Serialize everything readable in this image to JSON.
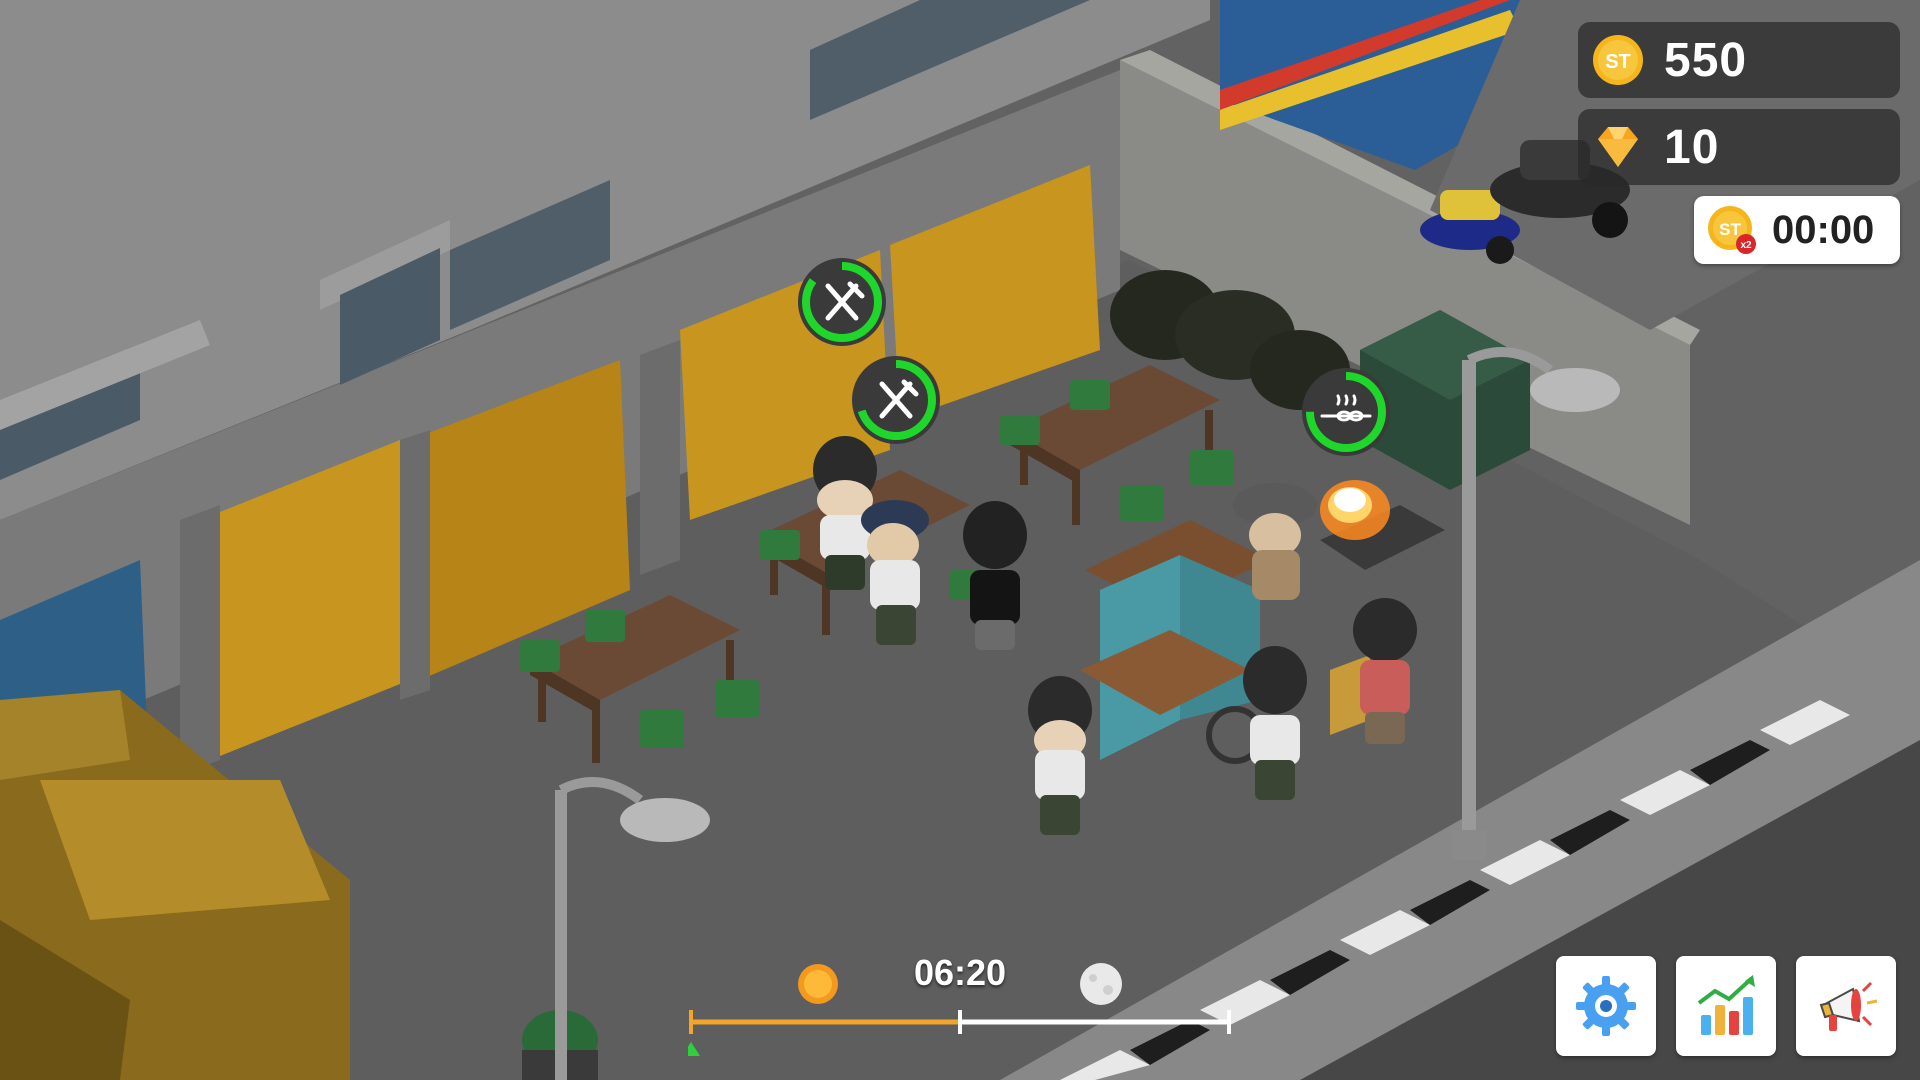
{
  "hud": {
    "coins": "550",
    "coin_icon_label": "ST",
    "gems": "10",
    "boost_icon_label": "ST",
    "boost_multiplier": "x2",
    "boost_timer": "00:00"
  },
  "day_clock": {
    "time": "06:20",
    "day_progress": 0.5
  },
  "order_bubbles": [
    {
      "icon": "fork-knife-icon",
      "progress": 0.85
    },
    {
      "icon": "fork-knife-icon",
      "progress": 0.7
    },
    {
      "icon": "satay-skewer-icon",
      "progress": 0.75
    }
  ],
  "buttons": {
    "settings": "gear-icon",
    "stats": "bar-chart-icon",
    "marketing": "megaphone-icon"
  },
  "colors": {
    "progress_green": "#1fd62a",
    "coin_gold": "#f6b51b",
    "gem_orange": "#f7a51e",
    "timeline_orange": "#f3a52b",
    "settings_blue": "#3a8fe0"
  }
}
